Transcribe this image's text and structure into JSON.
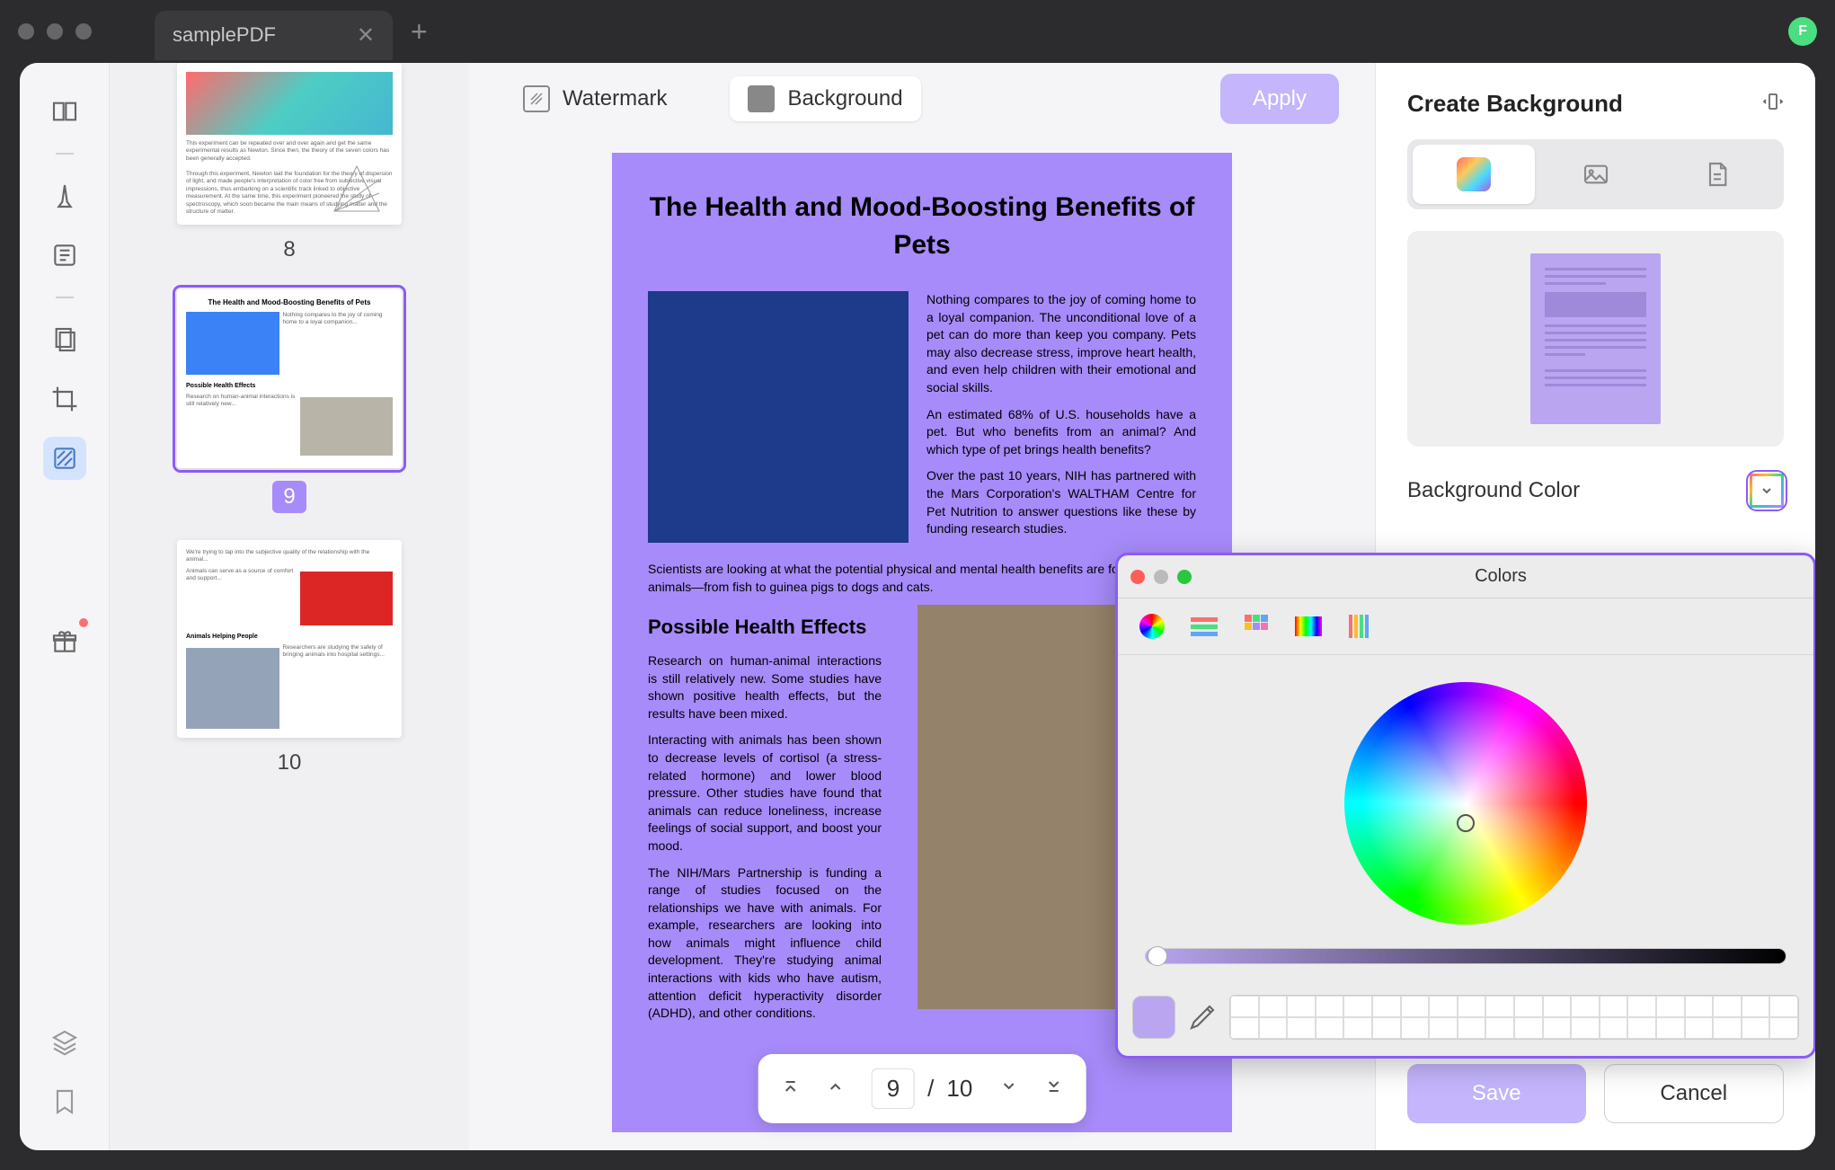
{
  "titlebar": {
    "tab_title": "samplePDF",
    "avatar_letter": "F"
  },
  "left_tools": [
    "reader",
    "highlight",
    "edit",
    "pages",
    "crop",
    "watermark"
  ],
  "thumbnails": [
    {
      "num": "8",
      "selected": false
    },
    {
      "num": "9",
      "selected": true
    },
    {
      "num": "10",
      "selected": false
    }
  ],
  "center_header": {
    "watermark": "Watermark",
    "background": "Background",
    "apply": "Apply"
  },
  "page": {
    "title": "The Health and Mood-Boosting Benefits of Pets",
    "p1": "Nothing compares to the joy of coming home to a loyal companion. The unconditional love of a pet can do more than keep you company. Pets may also decrease stress, improve heart health, and even help children with their emotional and social skills.",
    "p2": "An estimated 68% of U.S. households have a pet. But who benefits from an animal? And which type of pet brings health benefits?",
    "p3": "Over the past 10 years, NIH has partnered with the Mars Corporation's WALTHAM Centre for Pet Nutrition to answer questions like these by funding research studies.",
    "p4": "Scientists are looking at what the potential physical and mental health benefits are for different animals—from fish to guinea pigs to dogs and cats.",
    "h2": "Possible Health Effects",
    "p5": "Research on human-animal interactions is still relatively new. Some studies have shown positive health effects, but the results have been mixed.",
    "p6": "Interacting with animals has been shown to decrease levels of cortisol (a stress-related hormone) and lower blood pressure. Other studies have found that animals can reduce loneliness, increase feelings of social support, and boost your mood.",
    "p7": "The NIH/Mars Partnership is funding a range of studies focused on the relationships we have with animals. For example, researchers are looking into how animals might influence child development. They're studying animal interactions with kids who have autism, attention deficit hyperactivity disorder (ADHD), and other conditions."
  },
  "page_nav": {
    "current": "9",
    "sep": "/",
    "total": "10"
  },
  "right_panel": {
    "title": "Create Background",
    "bg_color_label": "Background Color",
    "save": "Save",
    "cancel": "Cancel"
  },
  "color_popup": {
    "title": "Colors"
  },
  "colors": {
    "accent": "#a78bfa",
    "accent_light": "#c4b5fd"
  }
}
